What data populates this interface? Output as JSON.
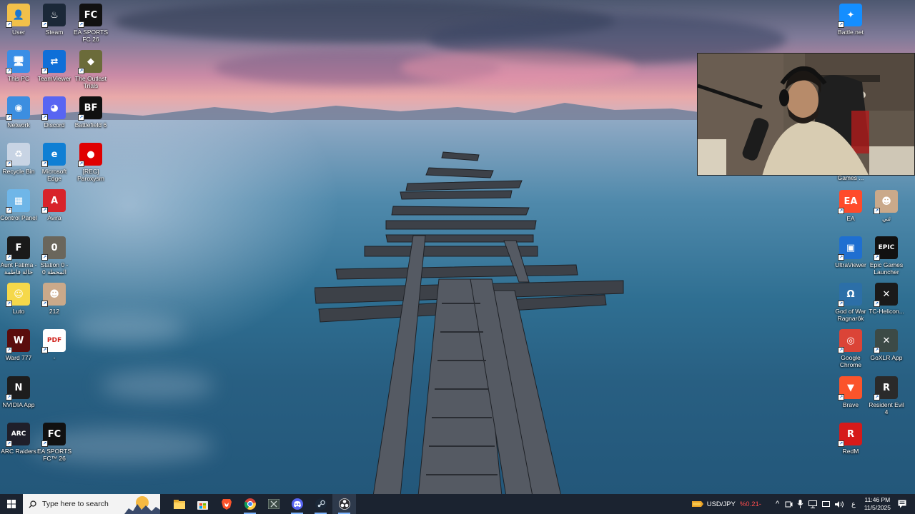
{
  "desktop": {
    "left_icons": [
      {
        "label": "User",
        "icon": "folder-user-icon"
      },
      {
        "label": "Steam",
        "icon": "steam-icon"
      },
      {
        "label": "EA SPORTS FC 26",
        "icon": "fc26-icon"
      },
      {
        "label": "This PC",
        "icon": "computer-icon"
      },
      {
        "label": "TeamViewer",
        "icon": "teamviewer-icon"
      },
      {
        "label": "The Outlast Trials",
        "icon": "outlast-icon"
      },
      {
        "label": "Network",
        "icon": "network-icon"
      },
      {
        "label": "Discord",
        "icon": "discord-icon"
      },
      {
        "label": "Battlefield 6",
        "icon": "battlefield-icon"
      },
      {
        "label": "Recycle Bin",
        "icon": "recycle-bin-icon"
      },
      {
        "label": "Microsoft Edge",
        "icon": "edge-icon"
      },
      {
        "label": "[REC] Paroxysm",
        "icon": "rec-icon"
      },
      {
        "label": "Control Panel",
        "icon": "control-panel-icon"
      },
      {
        "label": "Avira",
        "icon": "avira-icon"
      },
      {
        "label": "Aunt Fatima - خالة فاطمة",
        "icon": "aunt-fatima-icon"
      },
      {
        "label": "Station 0 - المحطة 0",
        "icon": "station-icon"
      },
      {
        "label": "Luto",
        "icon": "luto-icon"
      },
      {
        "label": "212",
        "icon": "photo-icon"
      },
      {
        "label": "Ward 777",
        "icon": "ward-icon"
      },
      {
        "label": "-",
        "icon": "pdf-icon"
      },
      {
        "label": "NVIDIA App",
        "icon": "nvidia-icon"
      },
      {
        "label": "ARC Raiders",
        "icon": "arc-raiders-icon"
      },
      {
        "label": "EA SPORTS FC™ 26",
        "icon": "fc26-icon"
      }
    ],
    "right_icons": [
      {
        "label": "Battle.net",
        "icon": "battlenet-icon"
      },
      {
        "label": "Games ...",
        "icon": "games-icon"
      },
      {
        "label": "EA",
        "icon": "ea-icon"
      },
      {
        "label": "ثني",
        "icon": "photo-icon"
      },
      {
        "label": "UltraViewer",
        "icon": "ultraviewer-icon"
      },
      {
        "label": "Epic Games Launcher",
        "icon": "epic-icon"
      },
      {
        "label": "God of War Ragnarök",
        "icon": "god-of-war-icon"
      },
      {
        "label": "TC-Helicon...",
        "icon": "tc-helicon-icon"
      },
      {
        "label": "Google Chrome",
        "icon": "chrome-icon"
      },
      {
        "label": "GoXLR App",
        "icon": "goxlr-icon"
      },
      {
        "label": "Brave",
        "icon": "brave-icon"
      },
      {
        "label": "Resident Evil 4",
        "icon": "re4-icon"
      },
      {
        "label": "RedM",
        "icon": "redm-icon"
      }
    ],
    "icon_glyphs": {
      "steam": "♨",
      "fc26": "FC26",
      "battlefield": "BF",
      "epic": "EPIC",
      "ea": "EA",
      "pdf": "PDF",
      "redm": "R",
      "arc": "ARC"
    }
  },
  "taskbar": {
    "search_placeholder": "Type here to search",
    "apps": [
      "file-explorer-icon",
      "store-icon",
      "brave-icon",
      "chrome-icon",
      "goxlr-icon",
      "discord-icon",
      "steam-icon",
      "obs-icon"
    ],
    "ticker": {
      "label": "USD/JPY",
      "change": "%0.21-"
    },
    "lang": "ع",
    "time": "11:46 PM",
    "date": "11/5/2025"
  },
  "colors": {
    "taskbar": "#1b2330",
    "accent": "#7fb6ff",
    "ticker_change": "#ff4d4d"
  }
}
